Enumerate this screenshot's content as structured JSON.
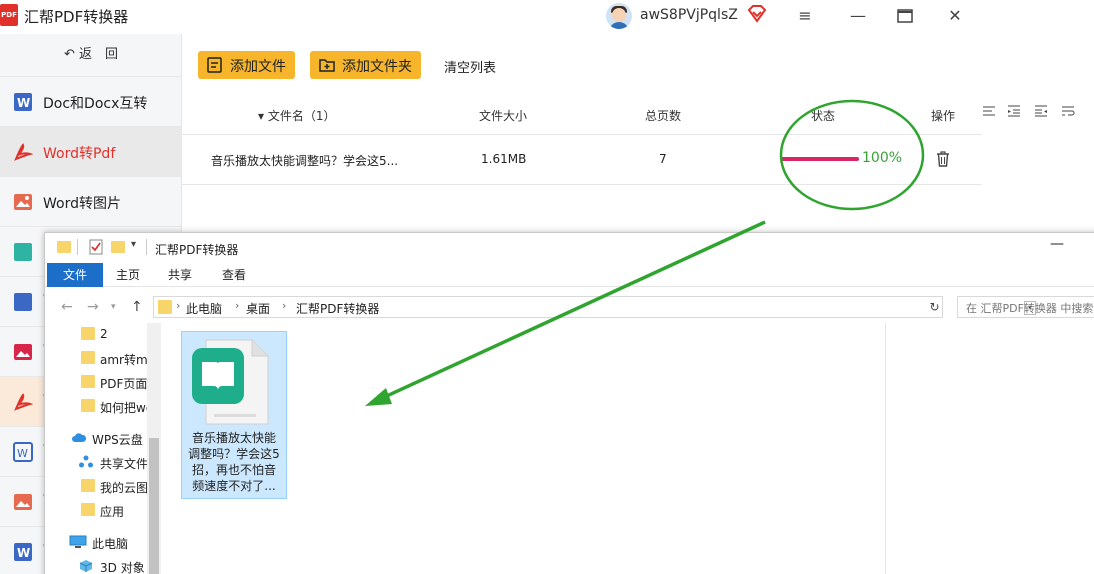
{
  "app": {
    "title": "汇帮PDF转换器",
    "logo_text": "PDF",
    "username": "awS8PVjPqlsZ",
    "colors": {
      "accent": "#f7b52c",
      "active_text": "#e0312b",
      "progress_bar": "#d82563",
      "progress_text": "#3aa13a",
      "annotation": "#2fa52f"
    }
  },
  "sidebar": {
    "back_label": "返　回",
    "items": [
      {
        "label": "Doc和Docx互转",
        "icon": "word-doc-icon"
      },
      {
        "label": "Word转Pdf",
        "icon": "pdf-icon",
        "active": true
      },
      {
        "label": "Word转图片",
        "icon": "image-icon"
      }
    ],
    "covered_initials": [
      "W",
      "W",
      "W",
      "W",
      "W",
      "W"
    ]
  },
  "toolbar": {
    "add_file_label": "添加文件",
    "add_folder_label": "添加文件夹",
    "clear_label": "清空列表"
  },
  "table": {
    "headers": {
      "name": "▾ 文件名（1）",
      "size": "文件大小",
      "pages": "总页数",
      "status": "状态",
      "action": "操作"
    },
    "rows": [
      {
        "name": "音乐播放太快能调整吗？学会这5...",
        "size": "1.61MB",
        "pages": "7",
        "progress_percent": 100,
        "progress_label": "100%"
      }
    ]
  },
  "explorer": {
    "title": "汇帮PDF转换器",
    "ribbon_tabs": [
      "文件",
      "主页",
      "共享",
      "查看"
    ],
    "address": [
      "此电脑",
      "桌面",
      "汇帮PDF转换器"
    ],
    "search_placeholder": "在 汇帮PDF转换器 中搜索",
    "tree": [
      {
        "label": "2",
        "icon": "folder-icon"
      },
      {
        "label": "amr转m",
        "icon": "folder-icon"
      },
      {
        "label": "PDF页面",
        "icon": "folder-icon"
      },
      {
        "label": "如何把wo",
        "icon": "folder-icon"
      },
      {
        "label": "WPS云盘",
        "icon": "cloud-icon"
      },
      {
        "label": "共享文件",
        "icon": "share-icon"
      },
      {
        "label": "我的云图",
        "icon": "folder-icon"
      },
      {
        "label": "应用",
        "icon": "folder-icon"
      },
      {
        "label": "此电脑",
        "icon": "computer-icon"
      },
      {
        "label": "3D 对象",
        "icon": "3d-objects-icon"
      }
    ],
    "file": {
      "label": "音乐播放太快能调整吗？学会这5招，再也不怕音频速度不对了...",
      "label_lines": [
        "音乐播放太快能",
        "调整吗？学会这5",
        "招，再也不怕音",
        "频速度不对了..."
      ],
      "icon": "book-file-icon"
    }
  }
}
